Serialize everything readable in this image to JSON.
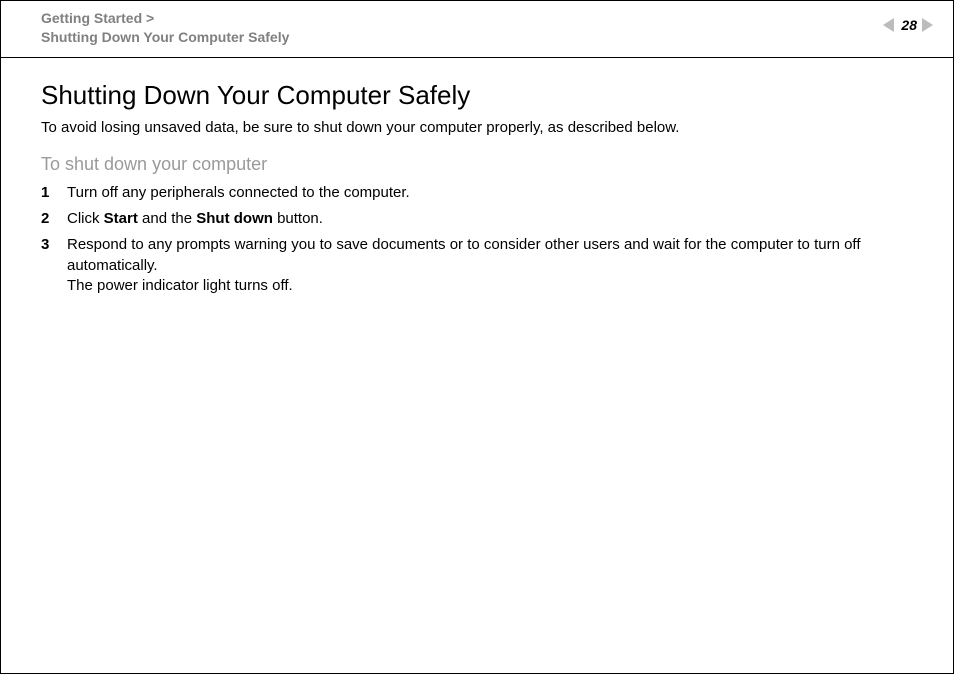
{
  "header": {
    "breadcrumb_line1": "Getting Started >",
    "breadcrumb_line2": "Shutting Down Your Computer Safely",
    "page_number": "28"
  },
  "content": {
    "title": "Shutting Down Your Computer Safely",
    "intro": "To avoid losing unsaved data, be sure to shut down your computer properly, as described below.",
    "subheading": "To shut down your computer",
    "steps": [
      {
        "num": "1",
        "text_plain": "Turn off any peripherals connected to the computer."
      },
      {
        "num": "2",
        "prefix": "Click ",
        "bold1": "Start",
        "mid": " and the ",
        "bold2": "Shut down",
        "suffix": " button."
      },
      {
        "num": "3",
        "text_plain": "Respond to any prompts warning you to save documents or to consider other users and wait for the computer to turn off automatically.",
        "text_line2": "The power indicator light turns off."
      }
    ]
  }
}
